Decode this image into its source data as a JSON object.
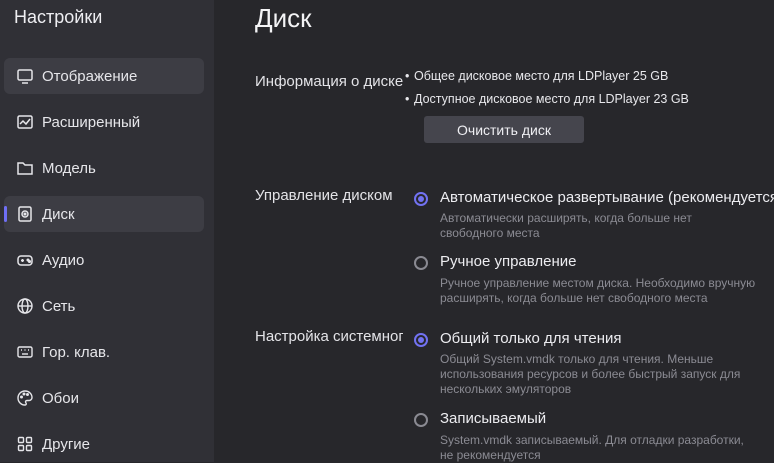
{
  "sidebar": {
    "title": "Настройки",
    "items": [
      {
        "label": "Отображение",
        "icon": "monitor-icon"
      },
      {
        "label": "Расширенный",
        "icon": "chart-icon"
      },
      {
        "label": "Модель",
        "icon": "folder-icon"
      },
      {
        "label": "Диск",
        "icon": "disk-icon"
      },
      {
        "label": "Аудио",
        "icon": "gamepad-icon"
      },
      {
        "label": "Сеть",
        "icon": "globe-icon"
      },
      {
        "label": "Гор. клав.",
        "icon": "keyboard-icon"
      },
      {
        "label": "Обои",
        "icon": "palette-icon"
      },
      {
        "label": "Другие",
        "icon": "grid-icon"
      }
    ],
    "active": "Диск"
  },
  "main": {
    "title": "Диск",
    "disk_info": {
      "label": "Информация о диске",
      "total": "Общее дисковое место для LDPlayer 25 GB",
      "available": "Доступное дисковое место для LDPlayer 23 GB",
      "clear_button": "Очистить диск"
    },
    "disk_management": {
      "label": "Управление диском",
      "auto_label": "Автоматическое развертывание (рекомендуется)",
      "auto_desc": "Автоматически расширять, когда больше нет свободного места",
      "manual_label": "Ручное управление",
      "manual_desc": "Ручное управление местом диска. Необходимо вручную расширять, когда больше нет свободного места",
      "selected": "auto"
    },
    "system_settings": {
      "label": "Настройка системного диска",
      "readonly_label": "Общий только для чтения",
      "readonly_desc": "Общий System.vmdk только для чтения. Меньше использования ресурсов и более быстрый запуск для нескольких эмуляторов",
      "writable_label": "Записываемый",
      "writable_desc": "System.vmdk записываемый. Для отладки разработки, не рекомендуется",
      "selected": "readonly"
    },
    "accent_color": "#7272f2"
  }
}
